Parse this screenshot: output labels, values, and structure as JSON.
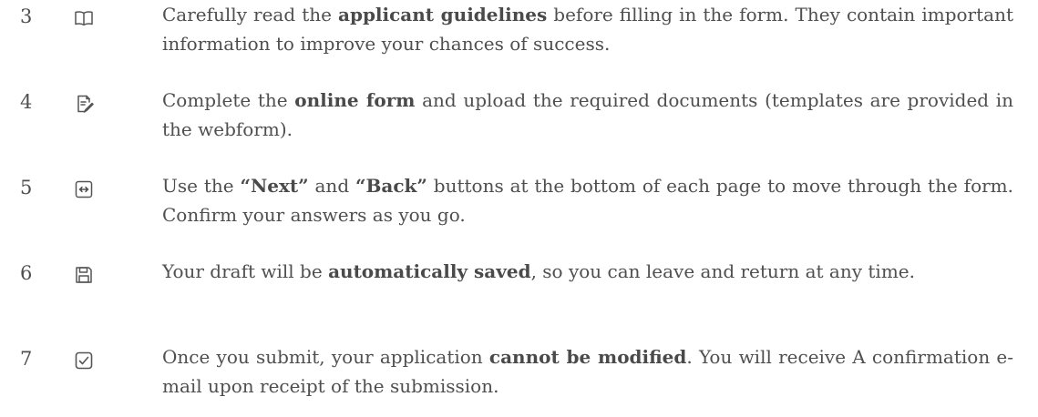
{
  "steps": [
    {
      "number": "3",
      "icon": "open-book-icon",
      "text_1": "Carefully read the ",
      "bold_1": "applicant guidelines",
      "text_2": " before filling in the form. They contain important information to improve your chances of success."
    },
    {
      "number": "4",
      "icon": "edit-document-icon",
      "text_1": "Complete the ",
      "bold_1": "online form",
      "text_2": " and upload the required documents (templates are provided in the webform)."
    },
    {
      "number": "5",
      "icon": "horizontal-arrows-icon",
      "text_1": "Use the ",
      "bold_1": "“Next”",
      "text_2": " and ",
      "bold_2": "“Back”",
      "text_3": " buttons at the bottom of each page to move through the form. Confirm your answers as you go."
    },
    {
      "number": "6",
      "icon": "save-floppy-icon",
      "text_1": "Your draft will be ",
      "bold_1": "automatically saved",
      "text_2": ", so you can leave and return at any time."
    },
    {
      "number": "7",
      "icon": "checkbox-icon",
      "text_1": "Once you submit, your application ",
      "bold_1": "cannot be modified",
      "text_2": ". You will receive A confirmation e-mail upon receipt of the submission."
    }
  ]
}
